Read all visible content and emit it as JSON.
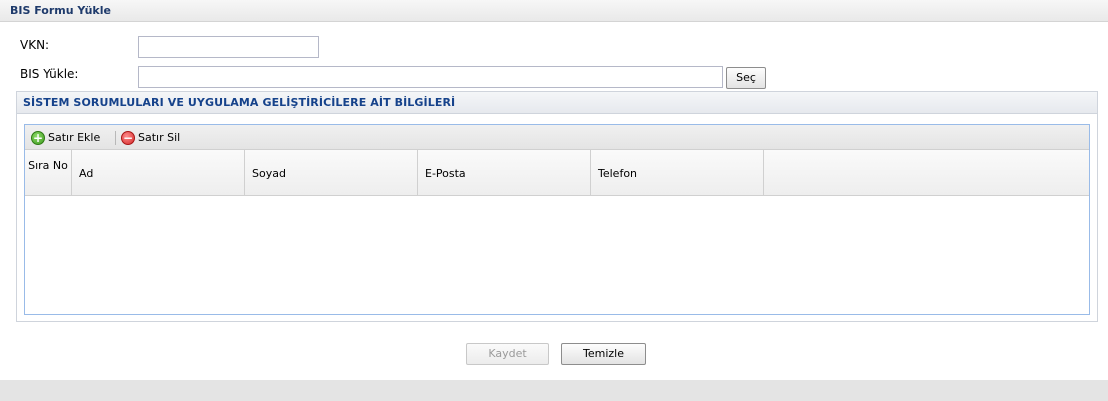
{
  "panel": {
    "title": "BIS Formu Yükle"
  },
  "form": {
    "vkn_label": "VKN:",
    "vkn_value": "",
    "bis_label": "BIS Yükle:",
    "bis_value": "",
    "browse_label": "Seç"
  },
  "section": {
    "title": "SİSTEM SORUMLULARI VE UYGULAMA GELİŞTİRİCİLERE AİT BİLGİLERİ"
  },
  "toolbar": {
    "add_label": "Satır Ekle",
    "delete_label": "Satır Sil"
  },
  "grid": {
    "columns": [
      "Sıra No",
      "Ad",
      "Soyad",
      "E-Posta",
      "Telefon"
    ],
    "rows": []
  },
  "actions": {
    "save_label": "Kaydet",
    "clear_label": "Temizle"
  },
  "colors": {
    "title_text": "#15428b",
    "grid_border": "#99bbe8",
    "add_icon": "#3c9a1d",
    "delete_icon": "#d42a2a"
  },
  "icons": {
    "add": "add-circle-icon",
    "delete": "remove-circle-icon"
  }
}
